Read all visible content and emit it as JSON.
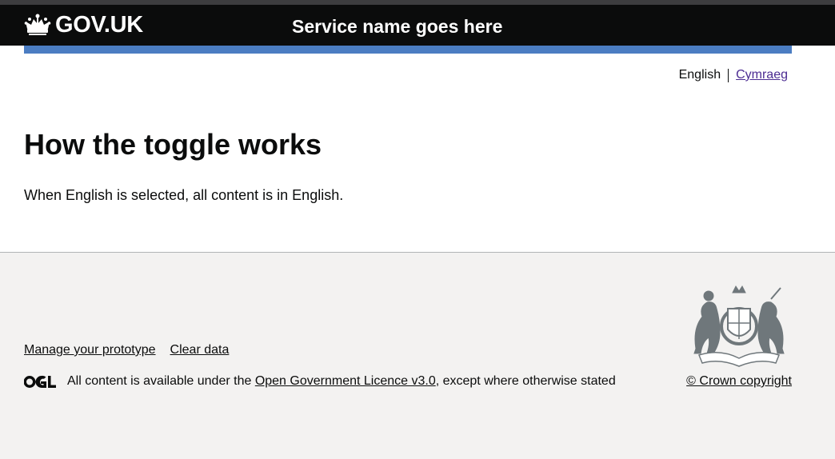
{
  "header": {
    "logo_text": "GOV.UK",
    "service_name": "Service name goes here",
    "accent_color": "#4b7dc2"
  },
  "language_toggle": {
    "current": "English",
    "other": "Cymraeg"
  },
  "main": {
    "title": "How the toggle works",
    "body": "When English is selected, all content is in English."
  },
  "footer": {
    "links": [
      "Manage your prototype",
      "Clear data"
    ],
    "licence_prefix": "All content is available under the ",
    "licence_link": "Open Government Licence v3.0",
    "licence_suffix": ", except where otherwise stated",
    "copyright": "© Crown copyright",
    "icons": {
      "ogl": "ogl-logo-icon",
      "crest": "royal-coat-of-arms-icon",
      "crown": "crown-icon"
    }
  }
}
